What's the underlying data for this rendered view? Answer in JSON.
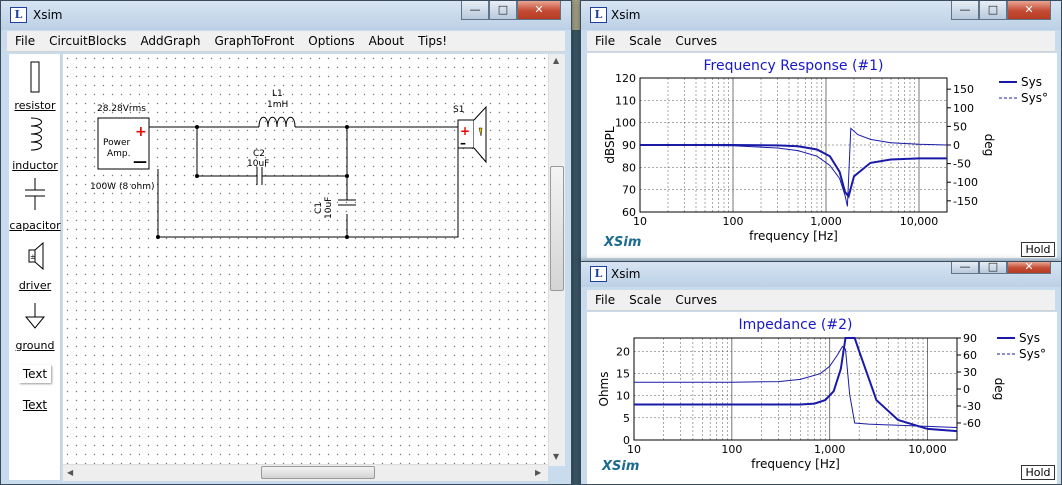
{
  "app": {
    "title": "Xsim"
  },
  "main_window": {
    "title": "Xsim",
    "menu": [
      "File",
      "CircuitBlocks",
      "AddGraph",
      "GraphToFront",
      "Options",
      "About",
      "Tips!"
    ],
    "palette": [
      {
        "label": "resistor",
        "icon": "resistor-icon"
      },
      {
        "label": "inductor",
        "icon": "inductor-icon"
      },
      {
        "label": "capacitor",
        "icon": "capacitor-icon"
      },
      {
        "label": "driver",
        "icon": "driver-icon"
      },
      {
        "label": "ground",
        "icon": "ground-icon"
      },
      {
        "label": "Text",
        "icon": "text-icon"
      },
      {
        "label": "Text",
        "icon": "text-link"
      }
    ],
    "circuit": {
      "source_voltage": "28.28Vrms",
      "source_name_1": "Power",
      "source_name_2": "Amp.",
      "source_rating": "100W (8 ohm)",
      "l1_name": "L1",
      "l1_value": "1mH",
      "c2_name": "C2",
      "c2_value": "10uF",
      "c1_name": "C1",
      "c1_value": "10uF",
      "speaker_name": "S1"
    }
  },
  "graph1": {
    "title": "Xsim",
    "menu": [
      "File",
      "Scale",
      "Curves"
    ],
    "plot_title": "Frequency Response (#1)",
    "ylabel": "dBSPL",
    "y2label": "deg",
    "xlabel": "frequency [Hz]",
    "yticks": [
      "120",
      "110",
      "100",
      "90",
      "80",
      "70",
      "60"
    ],
    "y2ticks": [
      "150",
      "100",
      "50",
      "0",
      "-50",
      "-100",
      "-150"
    ],
    "xticks": [
      "10",
      "100",
      "1,000",
      "10,000"
    ],
    "legend": [
      "Sys",
      "Sys°"
    ],
    "logo": "XSim",
    "hold_label": "Hold"
  },
  "graph2": {
    "title": "Xsim",
    "menu": [
      "File",
      "Scale",
      "Curves"
    ],
    "plot_title": "Impedance (#2)",
    "ylabel": "Ohms",
    "y2label": "deg",
    "xlabel": "frequency [Hz]",
    "yticks": [
      "20",
      "15",
      "10",
      "5",
      "0"
    ],
    "y2ticks": [
      "90",
      "60",
      "30",
      "0",
      "-30",
      "-60"
    ],
    "xticks": [
      "10",
      "100",
      "1,000",
      "10,000"
    ],
    "legend": [
      "Sys",
      "Sys°"
    ],
    "logo": "XSim",
    "hold_label": "Hold"
  },
  "chart_data": [
    {
      "type": "line",
      "title": "Frequency Response (#1)",
      "xlabel": "frequency [Hz]",
      "ylabel": "dBSPL",
      "y2label": "deg",
      "x_scale": "log",
      "xlim": [
        10,
        20000
      ],
      "ylim": [
        60,
        120
      ],
      "y2lim": [
        -180,
        180
      ],
      "grid": true,
      "legend_placement": "top-right",
      "series": [
        {
          "name": "Sys",
          "axis": "left",
          "style": "solid",
          "x": [
            10,
            100,
            300,
            500,
            800,
            1100,
            1400,
            1600,
            1750,
            2000,
            3000,
            5000,
            10000,
            20000
          ],
          "y": [
            90,
            90,
            89.8,
            89.4,
            88,
            85,
            78,
            69,
            67,
            76,
            82,
            83.5,
            84,
            84
          ]
        },
        {
          "name": "Sys°",
          "axis": "right",
          "style": "thin",
          "x": [
            10,
            100,
            300,
            500,
            800,
            1100,
            1400,
            1600,
            1700,
            1850,
            2200,
            3000,
            5000,
            10000,
            20000
          ],
          "y": [
            0,
            -2,
            -8,
            -15,
            -30,
            -55,
            -90,
            -135,
            -165,
            45,
            28,
            15,
            6,
            2,
            0
          ]
        }
      ]
    },
    {
      "type": "line",
      "title": "Impedance (#2)",
      "xlabel": "frequency [Hz]",
      "ylabel": "Ohms",
      "y2label": "deg",
      "x_scale": "log",
      "xlim": [
        10,
        20000
      ],
      "ylim": [
        0,
        23
      ],
      "y2lim": [
        -90,
        90
      ],
      "grid": true,
      "legend_placement": "top-right",
      "series": [
        {
          "name": "Sys",
          "axis": "left",
          "style": "solid",
          "x": [
            10,
            100,
            300,
            500,
            700,
            900,
            1100,
            1300,
            1450,
            1550,
            1800,
            2000,
            2500,
            3000,
            5000,
            10000,
            20000
          ],
          "y": [
            8,
            8,
            8,
            8,
            8.2,
            9,
            11,
            16,
            23,
            23,
            23,
            20,
            14,
            9,
            4.5,
            2.5,
            2
          ]
        },
        {
          "name": "Sys°",
          "axis": "right",
          "style": "thin",
          "x": [
            10,
            100,
            300,
            500,
            800,
            1000,
            1200,
            1350,
            1450,
            1600,
            1800,
            2500,
            5000,
            10000,
            20000
          ],
          "y": [
            12,
            12,
            13,
            17,
            27,
            40,
            60,
            75,
            70,
            -10,
            -60,
            -62,
            -64,
            -66,
            -68
          ]
        }
      ]
    }
  ]
}
